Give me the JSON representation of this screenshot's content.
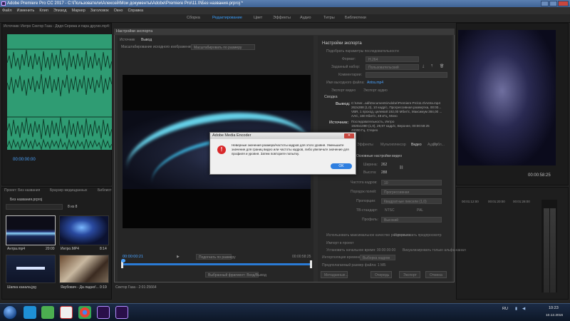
{
  "titlebar": {
    "title": "Adobe Premiere Pro CC 2017 - C:\\Пользователи\\Алексей\\Мои документы\\Adobe\\Premiere Pro\\11.0\\Без названия.prproj *"
  },
  "menu": [
    "Файл",
    "Изменить",
    "Клип",
    "Эпизод",
    "Маркер",
    "Заголовок",
    "Окно",
    "Справка"
  ],
  "workspaces": {
    "items": [
      "Сборка",
      "Редактирование",
      "Цвет",
      "Эффекты",
      "Аудио",
      "Титры",
      "Библиотеки"
    ],
    "active_index": 1
  },
  "source_panel": {
    "header": "Источник: Интро Сектор Газа - Дядя Сережа и пара других.mp4: 00:00:00:00",
    "timecode": "00:00:00:00"
  },
  "project_panel": {
    "tabs": [
      "Проект: Без названия",
      "Браузер медиаданных",
      "Библиот"
    ],
    "file": "Без названия.prproj",
    "count": "8 из 8",
    "items": [
      {
        "name": "Антра.mp4",
        "duration": "20:00"
      },
      {
        "name": "Интро.MP4",
        "duration": "8:14"
      },
      {
        "name": "Шапка канала.jpg",
        "duration": ""
      },
      {
        "name": "Якубович - Да ладно!...",
        "duration": "0:19"
      }
    ],
    "bottom_text": "Сектор Газа - 2:01:25664"
  },
  "program_panel": {
    "timecode": "00:00:58:25"
  },
  "timeline": {
    "ticks": [
      "00:01:12:00",
      "00:01:20:00",
      "00:01:28:00"
    ]
  },
  "export": {
    "title": "Настройки экспорта",
    "left_tabs": [
      "Источник",
      "Вывод"
    ],
    "scale_label": "Масштабирование исходного изображения:",
    "scale_value": "Масштабировать по размеру",
    "tc_in": "00:00:00:21",
    "tc_out": "00:00:58:25",
    "fit": "Подогнать по размеру",
    "range": "Выбранный фрагмент: Вход/Выход",
    "heading": "Настройки экспорта",
    "match_seq": "Подобрать параметры последовательности",
    "format_label": "Формат:",
    "format_value": "H.264",
    "preset_label": "Заданный набор:",
    "preset_value": "Пользовательский",
    "comments_label": "Комментарии:",
    "output_label": "Имя выходного файла:",
    "output_value": "Antra.mp4",
    "export_video": "Экспорт видео",
    "export_audio": "Экспорт аудио",
    "summary_title": "Сводка",
    "out_label": "Вывод:",
    "out_text": [
      "C:\\User...adi\\Documents\\Adobe\\Premiere Pro\\11.0\\Antra.mp4",
      "262x288 (1,0), 10 кадр/с, Прогрессивная развертка, 00:00...",
      "VBR, 1 проход, целевой 192,00 Мбит/с, Максимум 384,00 ...",
      "AAC, 160 Кбит/с, 48 кГц, Моно"
    ],
    "src_label": "Источник:",
    "src_text": [
      "Последовательность, Интро",
      "1920x1080 (1,0), 29,97 кадр/с, Верхнее, 00:00:59:25",
      "48000 Гц, Стерео"
    ],
    "tabs2": [
      "Эффекты",
      "Мультиплексор",
      "Видео",
      "Аудио",
      "Субтитры",
      "Публ..."
    ],
    "basic_video": "Основные настройки видео",
    "width_label": "Ширина:",
    "width_value": "262",
    "height_label": "Высота:",
    "height_value": "288",
    "fps_label": "Частота кадров:",
    "fps_value": "10",
    "field_label": "Порядок полей:",
    "field_value": "Прогрессивная",
    "aspect_label": "Пропорции:",
    "aspect_value": "Квадратные пиксели (1,0)",
    "tv_label": "ТВ-стандарт:",
    "ntsc": "NTSC",
    "pal": "PAL",
    "profile_label": "Профиль:",
    "profile_value": "Высокий",
    "level_label": "Уровень:",
    "level_value": "5.1",
    "max_quality": "Использовать максимальное качество рендеринга",
    "use_previews": "Использовать предпросмотр",
    "import_project": "Импорт в проект",
    "set_start": "Установить начальное время: 00:00:00:00",
    "frame_sampling_label": "Интерполяция времени:",
    "frame_sampling_value": "Выборка кадров",
    "render_alpha": "Визуализировать только альфа-канал",
    "file_size": "Предполагаемый размер файла: 1 МБ",
    "buttons": [
      "Метаданные...",
      "Очередь",
      "Экспорт",
      "Отмена"
    ]
  },
  "dialog": {
    "title": "Adobe Media Encoder",
    "close": "✕",
    "message": "Неверные значения размера/частоты кадров для этого уровня. Уменьшите значение для границ видео или частоты кадров, либо увеличьте значение для профиля и уровня. Затем повторите попытку.",
    "ok": "OK"
  },
  "taskbar": {
    "lang": "RU",
    "time": "10:23",
    "date": "10.12.2016"
  }
}
